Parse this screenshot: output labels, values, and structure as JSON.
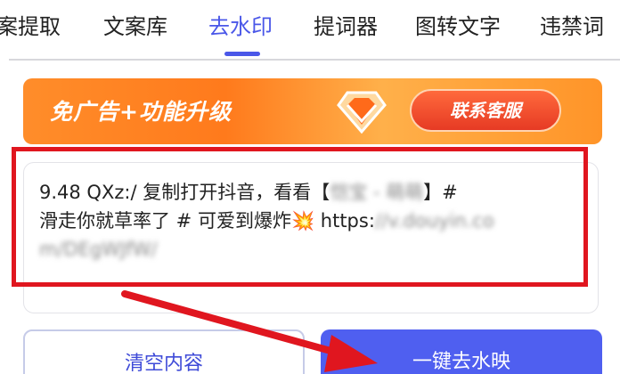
{
  "tabs": [
    {
      "label": "案提取",
      "active": false
    },
    {
      "label": "文案库",
      "active": false
    },
    {
      "label": "去水印",
      "active": true
    },
    {
      "label": "提词器",
      "active": false
    },
    {
      "label": "图转文字",
      "active": false
    },
    {
      "label": "违禁词",
      "active": false
    }
  ],
  "banner": {
    "text": "免广告+功能升级",
    "contact_label": "联系客服",
    "icon": "diamond-icon"
  },
  "input": {
    "line1_visible": "9.48 QXz:/ 复制打开抖音，看看【",
    "line1_blurred": "恺宝 - ",
    "line1_blurred2": "萌萌",
    "line1_end": "】#",
    "line2_visible": "滑走你就草率了 # 可爱到爆炸",
    "sparkle": "💥",
    "line2_url": " https:",
    "line2_url_blurred": "//v.douyin.co",
    "line3_blurred": "m/DEgWJfW/"
  },
  "buttons": {
    "clear_label": "清空内容",
    "remove_label": "一键去水映"
  },
  "colors": {
    "accent": "#4a57e8",
    "primary_button": "#4f5ff0",
    "banner_orange": "#ff8d2a",
    "annotation_red": "#e0161f"
  }
}
